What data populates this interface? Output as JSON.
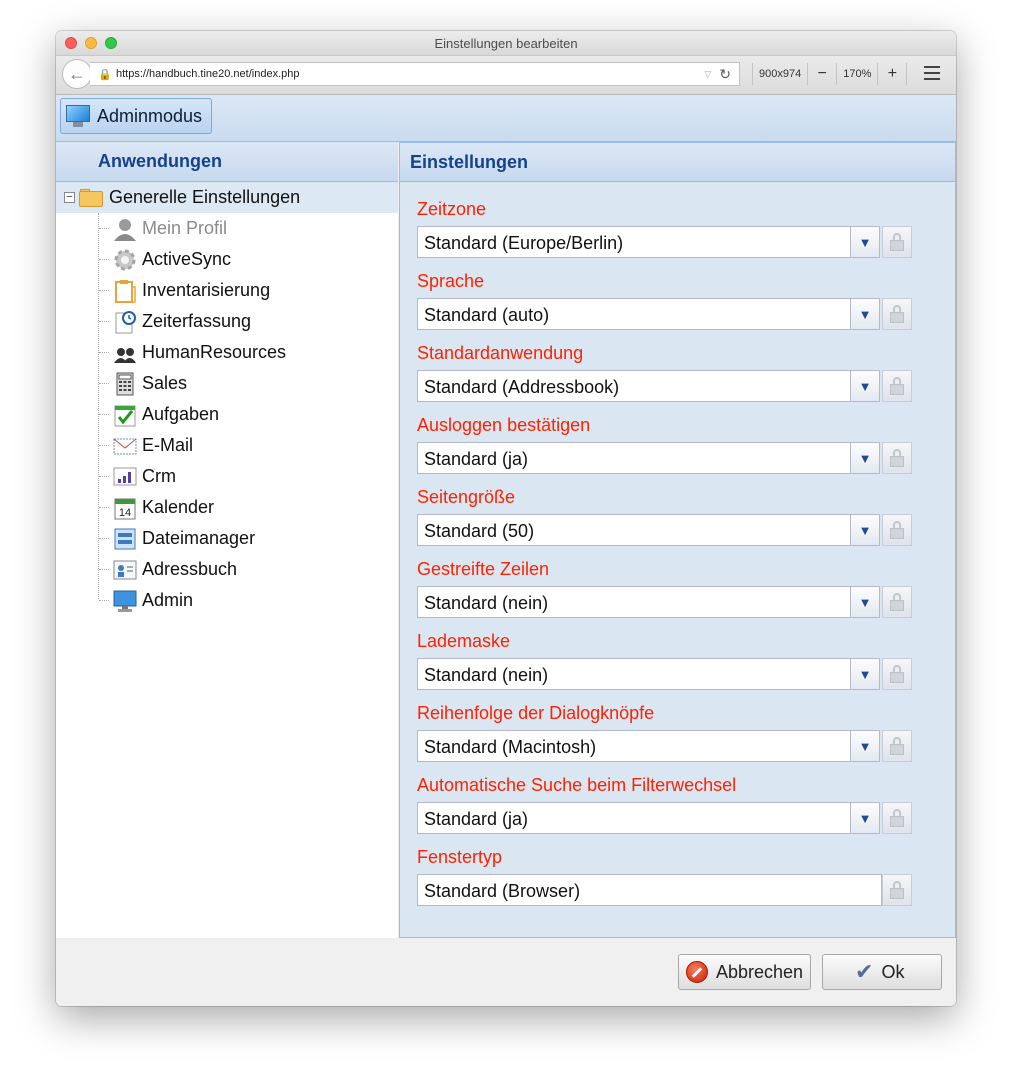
{
  "window": {
    "title": "Einstellungen bearbeiten"
  },
  "browser": {
    "url": "https://handbuch.tine20.net/index.php",
    "viewport": "900x974",
    "zoom": "170%",
    "zoom_out": "−",
    "zoom_in": "+"
  },
  "toolbar": {
    "admin_mode_label": "Adminmodus"
  },
  "left_panel": {
    "title": "Anwendungen",
    "root": {
      "label": "Generelle Einstellungen",
      "collapse": "−"
    },
    "items": [
      {
        "label": "Mein Profil",
        "icon": "user-icon"
      },
      {
        "label": "ActiveSync",
        "icon": "gear-icon"
      },
      {
        "label": "Inventarisierung",
        "icon": "clipboard-icon"
      },
      {
        "label": "Zeiterfassung",
        "icon": "clock-icon"
      },
      {
        "label": "HumanResources",
        "icon": "people-icon"
      },
      {
        "label": "Sales",
        "icon": "calculator-icon"
      },
      {
        "label": "Aufgaben",
        "icon": "tasks-icon"
      },
      {
        "label": "E-Mail",
        "icon": "mail-icon"
      },
      {
        "label": "Crm",
        "icon": "chart-icon"
      },
      {
        "label": "Kalender",
        "icon": "calendar-icon",
        "day": "14"
      },
      {
        "label": "Dateimanager",
        "icon": "filemanager-icon"
      },
      {
        "label": "Adressbuch",
        "icon": "addressbook-icon"
      },
      {
        "label": "Admin",
        "icon": "monitor-icon"
      }
    ]
  },
  "right_panel": {
    "title": "Einstellungen",
    "fields": [
      {
        "label": "Zeitzone",
        "value": "Standard (Europe/Berlin)"
      },
      {
        "label": "Sprache",
        "value": "Standard (auto)"
      },
      {
        "label": "Standardanwendung",
        "value": "Standard (Addressbook)"
      },
      {
        "label": "Ausloggen bestätigen",
        "value": "Standard (ja)"
      },
      {
        "label": "Seitengröße",
        "value": "Standard (50)"
      },
      {
        "label": "Gestreifte Zeilen",
        "value": "Standard (nein)"
      },
      {
        "label": "Lademaske",
        "value": "Standard (nein)"
      },
      {
        "label": "Reihenfolge der Dialogknöpfe",
        "value": "Standard (Macintosh)"
      },
      {
        "label": "Automatische Suche beim Filterwechsel",
        "value": "Standard (ja)"
      },
      {
        "label": "Fenstertyp",
        "value": "Standard (Browser)"
      }
    ]
  },
  "footer": {
    "cancel_label": "Abbrechen",
    "ok_label": "Ok"
  },
  "colors": {
    "label_red": "#ff2200",
    "header_blue": "#15428b"
  }
}
